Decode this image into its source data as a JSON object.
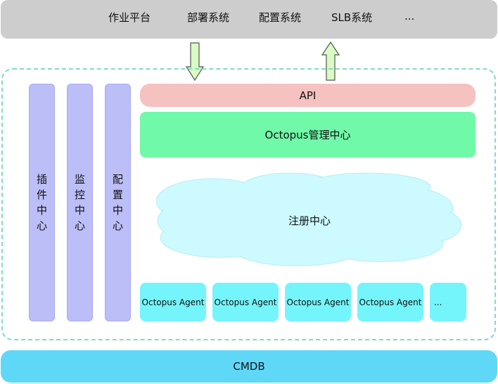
{
  "top_platforms": {
    "items": [
      {
        "label": "作业平台"
      },
      {
        "label": "部署系统"
      },
      {
        "label": "配置系统"
      },
      {
        "label": "SLB系统"
      },
      {
        "label": "..."
      }
    ]
  },
  "arrows": [
    {
      "name": "down-arrow",
      "direction": "down",
      "meaning": "platforms to API"
    },
    {
      "name": "up-arrow",
      "direction": "up",
      "meaning": "API to platforms"
    }
  ],
  "side_centers": [
    {
      "label": "插件中心",
      "chars": [
        "插",
        "件",
        "中",
        "心"
      ]
    },
    {
      "label": "监控中心",
      "chars": [
        "监",
        "控",
        "中",
        "心"
      ]
    },
    {
      "label": "配置中心",
      "chars": [
        "配",
        "置",
        "中",
        "心"
      ]
    }
  ],
  "api": {
    "label": "API"
  },
  "management_center": {
    "label": "Octopus管理中心"
  },
  "registry": {
    "label": "注册中心"
  },
  "agents": [
    {
      "label": "Octopus Agent"
    },
    {
      "label": "Octopus Agent"
    },
    {
      "label": "Octopus Agent"
    },
    {
      "label": "Octopus Agent"
    },
    {
      "label": "..."
    }
  ],
  "cmdb": {
    "label": "CMDB"
  },
  "colors": {
    "top_bar": "#cdcdcd",
    "container_border": "#7fdcc9",
    "pillar": "#bcbef8",
    "api": "#f5c2c0",
    "management": "#70f9a8",
    "cloud": "#ccfaff",
    "agent": "#74f5fb",
    "cmdb": "#5fd8f8",
    "arrow_fill": "#d8fcc4",
    "arrow_stroke": "#555555"
  }
}
